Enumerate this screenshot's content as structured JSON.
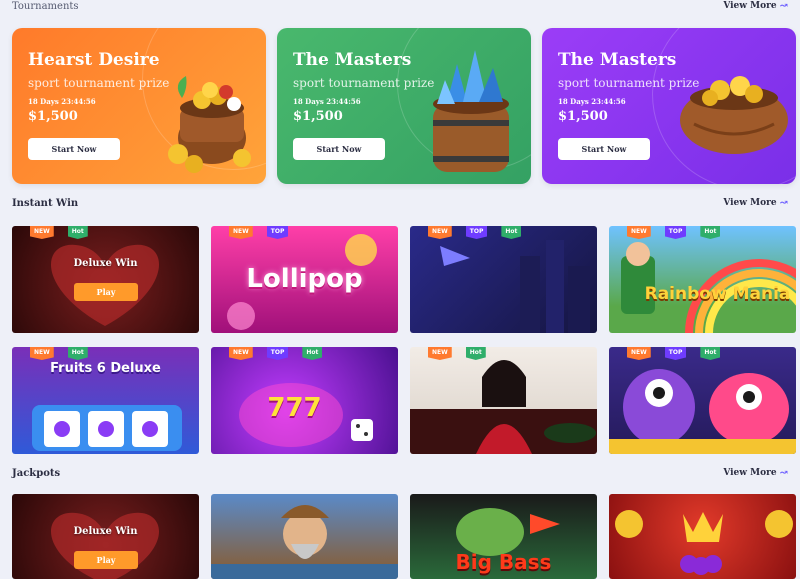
{
  "sections": {
    "tournaments": {
      "title": "Tournaments",
      "view_more": "View More"
    },
    "instant_win": {
      "title": "Instant Win",
      "view_more": "View More"
    },
    "jackpots": {
      "title": "Jackpots",
      "view_more": "View More"
    }
  },
  "tournaments": [
    {
      "title": "Hearst Desire",
      "subtitle": "sport tournament prize",
      "timer": "18 Days 23:44:56",
      "prize": "$1,500",
      "button": "Start Now",
      "color": "#ff8a2a"
    },
    {
      "title": "The Masters",
      "subtitle": "sport tournament prize",
      "timer": "18 Days 23:44:56",
      "prize": "$1,500",
      "button": "Start Now",
      "color": "#3db26b"
    },
    {
      "title": "The Masters",
      "subtitle": "sport tournament prize",
      "timer": "18 Days 23:44:56",
      "prize": "$1,500",
      "button": "Start Now",
      "color": "#8a3cf5"
    }
  ],
  "instant_win": [
    {
      "tags": [
        "NEW",
        "Hot"
      ],
      "overlay_title": "Deluxe Win",
      "overlay_button": "Play"
    },
    {
      "tags": [
        "NEW",
        "TOP"
      ],
      "game_title": "Lollipop"
    },
    {
      "tags": [
        "NEW",
        "TOP",
        "Hot"
      ]
    },
    {
      "tags": [
        "NEW",
        "TOP",
        "Hot"
      ],
      "game_title": "Rainbow Mania"
    },
    {
      "tags": [
        "NEW",
        "Hot"
      ],
      "game_title": "Fruits 6 Deluxe"
    },
    {
      "tags": [
        "NEW",
        "TOP",
        "Hot"
      ],
      "game_title": "777"
    },
    {
      "tags": [
        "NEW",
        "Hot"
      ]
    },
    {
      "tags": [
        "NEW",
        "TOP",
        "Hot"
      ]
    }
  ],
  "jackpots": [
    {
      "overlay_title": "Deluxe Win",
      "overlay_button": "Play"
    },
    {},
    {
      "game_title": "Big Bass"
    },
    {}
  ]
}
